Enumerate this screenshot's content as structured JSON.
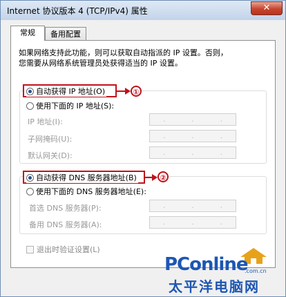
{
  "window": {
    "title": "Internet 协议版本 4 (TCP/IPv4) 属性",
    "close_glyph": "✕"
  },
  "tabs": [
    {
      "label": "常规"
    },
    {
      "label": "备用配置"
    }
  ],
  "general": {
    "description_line1": "如果网络支持此功能，则可以获取自动指派的 IP 设置。否则，",
    "description_line2": "您需要从网络系统管理员处获得适当的 IP 设置。",
    "ip_auto": {
      "label": "自动获得 IP 地址(O)",
      "checked": true
    },
    "ip_manual": {
      "label": "使用下面的 IP 地址(S):",
      "checked": false
    },
    "ip_fields": [
      {
        "label": "IP 地址(I):"
      },
      {
        "label": "子网掩码(U):"
      },
      {
        "label": "默认网关(D):"
      }
    ],
    "dns_auto": {
      "label": "自动获得 DNS 服务器地址(B)",
      "checked": true
    },
    "dns_manual": {
      "label": "使用下面的 DNS 服务器地址(E):",
      "checked": false
    },
    "dns_fields": [
      {
        "label": "首选 DNS 服务器(P):"
      },
      {
        "label": "备用 DNS 服务器(A):"
      }
    ],
    "validate_on_exit": {
      "label": "退出时验证设置(L)",
      "checked": false
    },
    "ip_dot": "."
  },
  "annotations": {
    "marker1": "①",
    "marker2": "②",
    "color": "#c0121c"
  },
  "watermark": {
    "brand": "PConline",
    "domain": ".com.cn",
    "slogan": "太平洋电脑网"
  }
}
